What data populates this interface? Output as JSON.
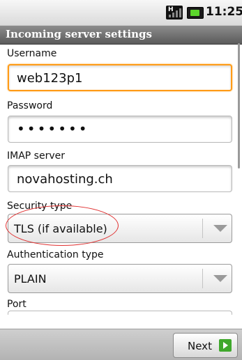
{
  "status_bar": {
    "time": "11:25",
    "signal_label": "H",
    "icons": [
      "signal-icon",
      "battery-icon"
    ]
  },
  "title": "Incoming server settings",
  "form": {
    "username_label": "Username",
    "username_value": "web123p1",
    "password_label": "Password",
    "password_value": "•••••••",
    "imap_label": "IMAP server",
    "imap_value": "novahosting.ch",
    "security_label": "Security type",
    "security_value": "TLS (if available)",
    "auth_label": "Authentication type",
    "auth_value": "PLAIN",
    "port_label": "Port"
  },
  "footer": {
    "next_label": "Next"
  },
  "colors": {
    "focus": "#ff9b17",
    "annotation": "#e03030",
    "next_icon": "#3fa82c"
  }
}
